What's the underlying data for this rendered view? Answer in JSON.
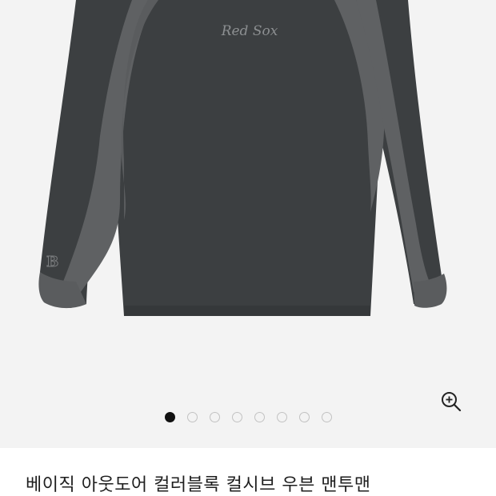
{
  "product": {
    "title": "베이직 아웃도어 컬러블록 컬시브 우븐 맨투맨",
    "print_text": "Red Sox",
    "sleeve_logo": "B"
  },
  "gallery": {
    "total_images": 8,
    "active_index": 0,
    "zoom_icon": "zoom-in-icon"
  },
  "colors": {
    "background": "#f3f3f3",
    "garment_body": "#3b3e40",
    "garment_panel": "#5c5e60",
    "active_dot": "#111111",
    "inactive_dot": "#c2c2c2"
  }
}
